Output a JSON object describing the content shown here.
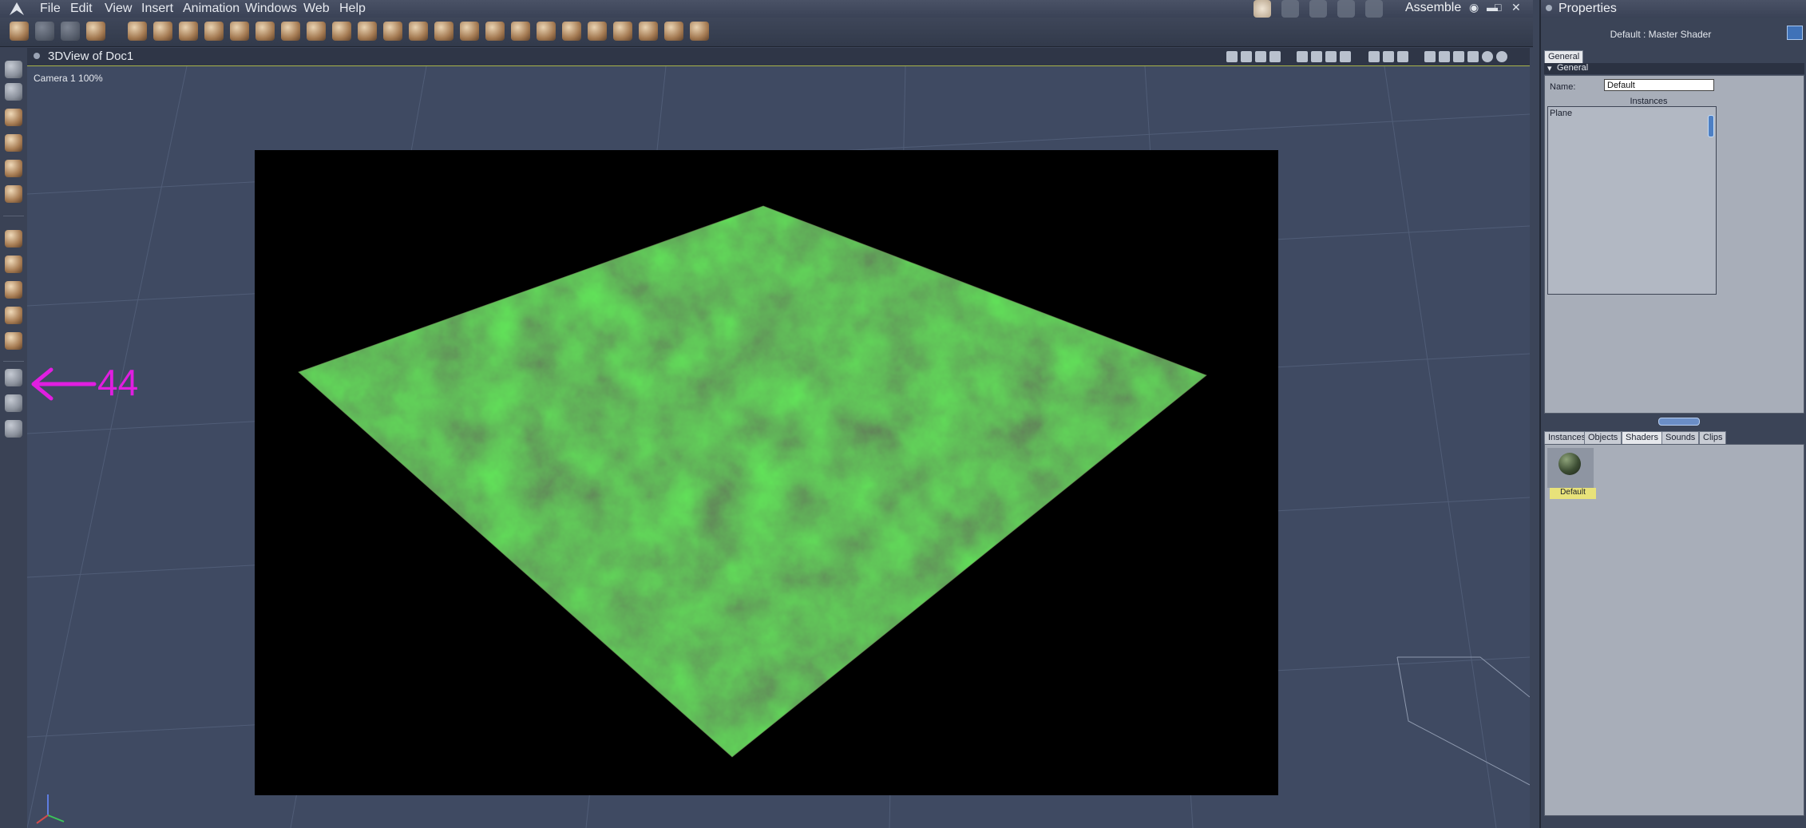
{
  "menu": {
    "items": [
      "File",
      "Edit",
      "View",
      "Insert",
      "Animation",
      "Windows",
      "Web",
      "Help"
    ],
    "mode": "Assemble"
  },
  "viewport": {
    "title": "3DView of Doc1",
    "camera_label": "Camera 1 100%"
  },
  "annotation": {
    "number": "44",
    "color": "#e01ee0"
  },
  "properties": {
    "title": "Properties",
    "shader_heading": "Default : Master Shader",
    "tab_general": "General",
    "section_general": "General",
    "name_label": "Name:",
    "name_value": "Default",
    "instances_label": "Instances",
    "instances": [
      "Plane"
    ]
  },
  "library": {
    "tabs": [
      "Instances",
      "Objects",
      "Shaders",
      "Sounds",
      "Clips"
    ],
    "active_tab": "Shaders",
    "items": [
      {
        "name": "Default"
      }
    ]
  },
  "icons": {
    "app_logo": "app-logo-icon",
    "camera_tool": "camera-icon",
    "hand_tool": "hand-icon",
    "zoom_tool": "magnifier-icon"
  }
}
